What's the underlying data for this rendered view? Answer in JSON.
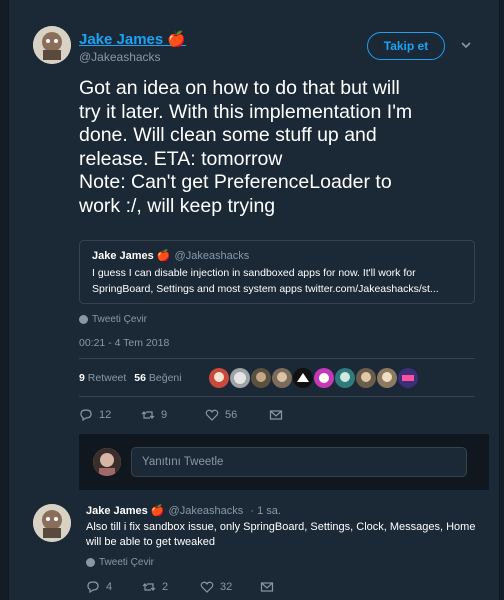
{
  "tweet": {
    "author_name": "Jake James 🍎",
    "author_handle": "@Jakeashacks",
    "follow_label": "Takip et",
    "text_lines": [
      "Got an idea on how to do that but will",
      "try it later. With this implementation I'm",
      "done. Will clean some stuff up and",
      "release. ETA: tomorrow",
      "Note: Can't get PreferenceLoader to",
      "work :/, will keep trying"
    ],
    "quote": {
      "name": "Jake James 🍎",
      "handle": "@Jakeashacks",
      "lines": [
        "I guess I can disable injection in sandboxed apps for now. It'll work for",
        "SpringBoard, Settings and most system apps twitter.com/Jakeashacks/st..."
      ]
    },
    "translate_label": "Tweeti Çevir",
    "timestamp": "00:21 - 4 Tem 2018",
    "retweets_count": "9",
    "retweets_label": "Retweet",
    "likes_count": "56",
    "likes_label": "Beğeni",
    "reply_count": "12",
    "retweet_action_count": "9",
    "like_action_count": "56",
    "reply_placeholder": "Yanıtını Tweetle"
  },
  "reply": {
    "author_name": "Jake James 🍎",
    "author_handle": "@Jakeashacks",
    "time": "· 1 sa.",
    "text_lines": [
      "Also till i fix sandbox issue, only SpringBoard, Settings, Clock, Messages, Home",
      "will be able to get tweaked"
    ],
    "translate_label": "Tweeti Çevir",
    "reply_count": "4",
    "retweet_count": "2",
    "like_count": "32"
  },
  "colors": {
    "background": "#141d26",
    "card": "#1b2836",
    "accent": "#1da1f2",
    "muted": "#8899a6",
    "border": "#38444d"
  }
}
